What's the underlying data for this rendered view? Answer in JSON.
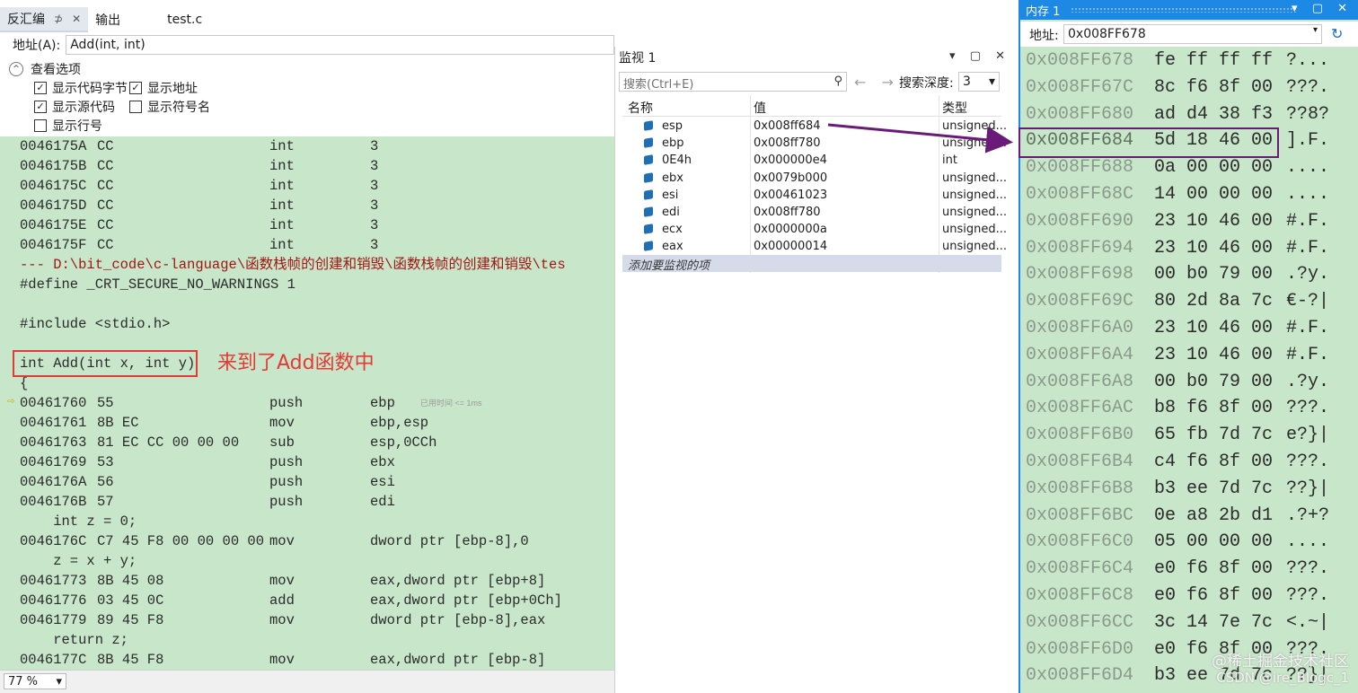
{
  "disasm": {
    "tabs": [
      {
        "label": "反汇编",
        "pin": "⊅",
        "close": "✕"
      },
      {
        "label": "输出"
      },
      {
        "label": "test.c"
      }
    ],
    "address_label": "地址(A):",
    "address_value": "Add(int, int)",
    "view_options": {
      "header": "查看选项",
      "collapse_icon": "^",
      "show_code_bytes": {
        "label": "显示代码字节",
        "checked": true
      },
      "show_address": {
        "label": "显示地址",
        "checked": true
      },
      "show_source": {
        "label": "显示源代码",
        "checked": true
      },
      "show_symbols": {
        "label": "显示符号名",
        "checked": false
      },
      "show_line_numbers": {
        "label": "显示行号",
        "checked": false
      }
    },
    "lines": [
      {
        "addr": "0046175A",
        "bytes": "CC",
        "op": "int",
        "args": "3"
      },
      {
        "addr": "0046175B",
        "bytes": "CC",
        "op": "int",
        "args": "3"
      },
      {
        "addr": "0046175C",
        "bytes": "CC",
        "op": "int",
        "args": "3"
      },
      {
        "addr": "0046175D",
        "bytes": "CC",
        "op": "int",
        "args": "3"
      },
      {
        "addr": "0046175E",
        "bytes": "CC",
        "op": "int",
        "args": "3"
      },
      {
        "addr": "0046175F",
        "bytes": "CC",
        "op": "int",
        "args": "3"
      },
      {
        "file": "--- D:\\bit_code\\c-language\\函数栈帧的创建和销毁\\函数栈帧的创建和销毁\\tes"
      },
      {
        "src": "#define _CRT_SECURE_NO_WARNINGS 1"
      },
      {
        "src": ""
      },
      {
        "src": "#include <stdio.h>"
      },
      {
        "src": ""
      },
      {
        "src": "int Add(int x, int y)"
      },
      {
        "src": "{"
      },
      {
        "addr": "00461760",
        "bytes": "55",
        "op": "push",
        "args": "ebp",
        "note": "已用时间 <= 1ms"
      },
      {
        "addr": "00461761",
        "bytes": "8B EC",
        "op": "mov",
        "args": "ebp,esp"
      },
      {
        "addr": "00461763",
        "bytes": "81 EC CC 00 00 00",
        "op": "sub",
        "args": "esp,0CCh"
      },
      {
        "addr": "00461769",
        "bytes": "53",
        "op": "push",
        "args": "ebx"
      },
      {
        "addr": "0046176A",
        "bytes": "56",
        "op": "push",
        "args": "esi"
      },
      {
        "addr": "0046176B",
        "bytes": "57",
        "op": "push",
        "args": "edi"
      },
      {
        "src": "    int z = 0;"
      },
      {
        "addr": "0046176C",
        "bytes": "C7 45 F8 00 00 00 00",
        "op": "mov",
        "args": "dword ptr [ebp-8],0"
      },
      {
        "src": "    z = x + y;"
      },
      {
        "addr": "00461773",
        "bytes": "8B 45 08",
        "op": "mov",
        "args": "eax,dword ptr [ebp+8]"
      },
      {
        "addr": "00461776",
        "bytes": "03 45 0C",
        "op": "add",
        "args": "eax,dword ptr [ebp+0Ch]"
      },
      {
        "addr": "00461779",
        "bytes": "89 45 F8",
        "op": "mov",
        "args": "dword ptr [ebp-8],eax"
      },
      {
        "src": "    return z;"
      },
      {
        "addr": "0046177C",
        "bytes": "8B 45 F8",
        "op": "mov",
        "args": "eax,dword ptr [ebp-8]"
      }
    ],
    "annotation": "来到了Add函数中",
    "current_line_marker": "⇨",
    "zoom": "77 %",
    "zoom_dd": "▾"
  },
  "watch": {
    "title": "监视 1",
    "title_controls": "▾ ▢ ✕",
    "search_placeholder": "搜索(Ctrl+E)",
    "search_icon": "⚲",
    "nav": "← →",
    "depth_label": "搜索深度:",
    "depth_value": "3",
    "depth_dd": "▾",
    "columns": {
      "name": "名称",
      "value": "值",
      "type": "类型"
    },
    "rows": [
      {
        "name": "esp",
        "value": "0x008ff684",
        "type": "unsigned..."
      },
      {
        "name": "ebp",
        "value": "0x008ff780",
        "type": "unsigned..."
      },
      {
        "name": "0E4h",
        "value": "0x000000e4",
        "type": "int"
      },
      {
        "name": "ebx",
        "value": "0x0079b000",
        "type": "unsigned..."
      },
      {
        "name": "esi",
        "value": "0x00461023",
        "type": "unsigned..."
      },
      {
        "name": "edi",
        "value": "0x008ff780",
        "type": "unsigned..."
      },
      {
        "name": "ecx",
        "value": "0x0000000a",
        "type": "unsigned..."
      },
      {
        "name": "eax",
        "value": "0x00000014",
        "type": "unsigned..."
      }
    ],
    "add_item": "添加要监视的项"
  },
  "memory": {
    "title": "内存 1",
    "title_controls": "▾ ▢ ✕",
    "address_label": "地址:",
    "address_value": "0x008FF678",
    "address_dd": "▾",
    "refresh_icon": "↻",
    "rows": [
      {
        "addr": "0x008FF678",
        "bytes": "fe ff ff ff",
        "ascii": "?..."
      },
      {
        "addr": "0x008FF67C",
        "bytes": "8c f6 8f 00",
        "ascii": "???."
      },
      {
        "addr": "0x008FF680",
        "bytes": "ad d4 38 f3",
        "ascii": "??8?"
      },
      {
        "addr": "0x008FF684",
        "bytes": "5d 18 46 00",
        "ascii": "].F."
      },
      {
        "addr": "0x008FF688",
        "bytes": "0a 00 00 00",
        "ascii": "...."
      },
      {
        "addr": "0x008FF68C",
        "bytes": "14 00 00 00",
        "ascii": "...."
      },
      {
        "addr": "0x008FF690",
        "bytes": "23 10 46 00",
        "ascii": "#.F."
      },
      {
        "addr": "0x008FF694",
        "bytes": "23 10 46 00",
        "ascii": "#.F."
      },
      {
        "addr": "0x008FF698",
        "bytes": "00 b0 79 00",
        "ascii": ".?y."
      },
      {
        "addr": "0x008FF69C",
        "bytes": "80 2d 8a 7c",
        "ascii": "€-?|"
      },
      {
        "addr": "0x008FF6A0",
        "bytes": "23 10 46 00",
        "ascii": "#.F."
      },
      {
        "addr": "0x008FF6A4",
        "bytes": "23 10 46 00",
        "ascii": "#.F."
      },
      {
        "addr": "0x008FF6A8",
        "bytes": "00 b0 79 00",
        "ascii": ".?y."
      },
      {
        "addr": "0x008FF6AC",
        "bytes": "b8 f6 8f 00",
        "ascii": "???."
      },
      {
        "addr": "0x008FF6B0",
        "bytes": "65 fb 7d 7c",
        "ascii": "e?}|"
      },
      {
        "addr": "0x008FF6B4",
        "bytes": "c4 f6 8f 00",
        "ascii": "???."
      },
      {
        "addr": "0x008FF6B8",
        "bytes": "b3 ee 7d 7c",
        "ascii": "??}|"
      },
      {
        "addr": "0x008FF6BC",
        "bytes": "0e a8 2b d1",
        "ascii": ".?+?"
      },
      {
        "addr": "0x008FF6C0",
        "bytes": "05 00 00 00",
        "ascii": "...."
      },
      {
        "addr": "0x008FF6C4",
        "bytes": "e0 f6 8f 00",
        "ascii": "???."
      },
      {
        "addr": "0x008FF6C8",
        "bytes": "e0 f6 8f 00",
        "ascii": "???."
      },
      {
        "addr": "0x008FF6CC",
        "bytes": "3c 14 7e 7c",
        "ascii": "<.~|"
      },
      {
        "addr": "0x008FF6D0",
        "bytes": "e0 f6 8f 00",
        "ascii": "???."
      },
      {
        "addr": "0x008FF6D4",
        "bytes": "b3 ee 7d 7c",
        "ascii": "??}|"
      }
    ],
    "highlight_index": 3,
    "watermark_1": "@稀土掘金技术社区",
    "watermark_2": "CSDN @ire_Blogc_1"
  },
  "colors": {
    "code_bg": "#c8e6c9",
    "accent": "#1e88e5",
    "annotation": "#e53935",
    "arrow": "#6a1b7a"
  }
}
